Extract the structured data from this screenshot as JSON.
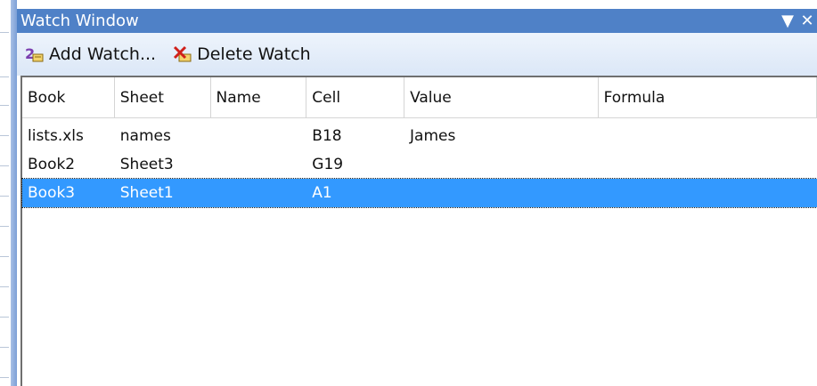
{
  "window": {
    "title": "Watch Window"
  },
  "toolbar": {
    "add_label": "Add Watch...",
    "delete_label": "Delete Watch"
  },
  "columns": [
    "Book",
    "Sheet",
    "Name",
    "Cell",
    "Value",
    "Formula"
  ],
  "rows": [
    {
      "book": "lists.xls",
      "sheet": "names",
      "name": "",
      "cell": "B18",
      "value": "James",
      "formula": ""
    },
    {
      "book": "Book2",
      "sheet": "Sheet3",
      "name": "",
      "cell": "G19",
      "value": "",
      "formula": ""
    },
    {
      "book": "Book3",
      "sheet": "Sheet1",
      "name": "",
      "cell": "A1",
      "value": "",
      "formula": "",
      "selected": true
    }
  ],
  "controls": {
    "dropdown_glyph": "▼",
    "close_glyph": "✕"
  },
  "colors": {
    "titlebar": "#4f81c7",
    "selection": "#3399ff"
  }
}
